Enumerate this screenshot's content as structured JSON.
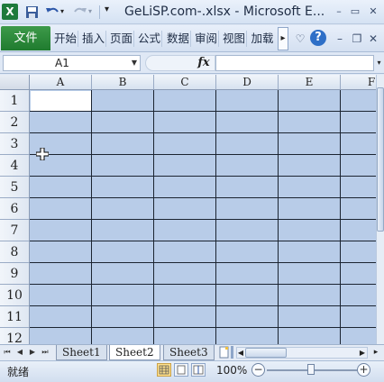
{
  "window": {
    "title": "GeLiSP.com-.xlsx - Microsoft E...",
    "minimize_glyph": "–",
    "restore_glyph": "▭",
    "close_glyph": "✕"
  },
  "quick_access": {
    "app_icon": "X",
    "icons": [
      "excel-logo-icon",
      "save-icon",
      "undo-icon",
      "redo-icon",
      "customize-dropdown-icon"
    ]
  },
  "ribbon": {
    "file_tab": "文件",
    "tabs": [
      "开始",
      "插入",
      "页面",
      "公式",
      "数据",
      "审阅",
      "视图",
      "加载"
    ],
    "more_glyph": "▸",
    "help_glyph": "?"
  },
  "formula_bar": {
    "name_box": "A1",
    "fx_label": "fx",
    "formula": ""
  },
  "grid": {
    "columns": [
      "A",
      "B",
      "C",
      "D",
      "E",
      "F"
    ],
    "rows": [
      "1",
      "2",
      "3",
      "4",
      "5",
      "6",
      "7",
      "8",
      "9",
      "10",
      "11",
      "12"
    ],
    "active_cell": "A1",
    "selection_color": "#b8cce8"
  },
  "sheets": {
    "tabs": [
      "Sheet1",
      "Sheet2",
      "Sheet3"
    ],
    "active": "Sheet2"
  },
  "status": {
    "text": "就绪",
    "zoom": "100%",
    "zoom_minus": "−",
    "zoom_plus": "+"
  },
  "colors": {
    "accent_file_tab": "#2a8a3a",
    "excel_green": "#1e7a3c",
    "selection": "#b8cce8"
  }
}
